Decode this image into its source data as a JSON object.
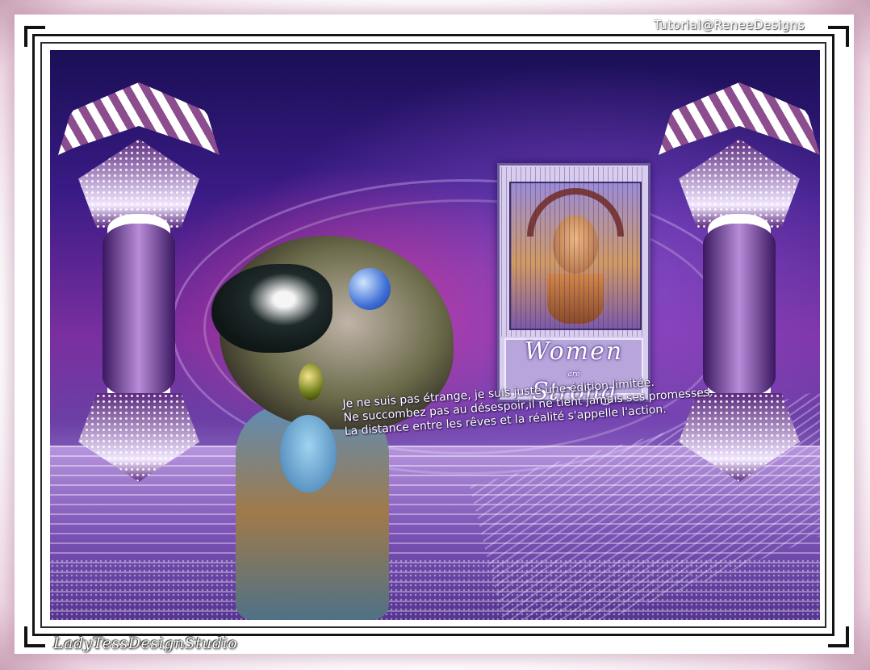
{
  "watermark_top": "Tutorial@ReneeDesigns",
  "watermark_bottom": "LadyTessDesignStudio",
  "poster": {
    "line1": "Women",
    "small": "are",
    "line2": "Strong"
  },
  "quote_lines": [
    "Je ne suis pas étrange, je suis juste une édition limitée.",
    "Ne succombez pas au désespoir,il ne tient jamais ses promesses.",
    "La distance entre les rêves et la réalité s'appelle l'action."
  ],
  "colors": {
    "frame": "#ffffff",
    "border": "#141414",
    "accent": "#7a2f9f",
    "text": "#ffffff"
  }
}
